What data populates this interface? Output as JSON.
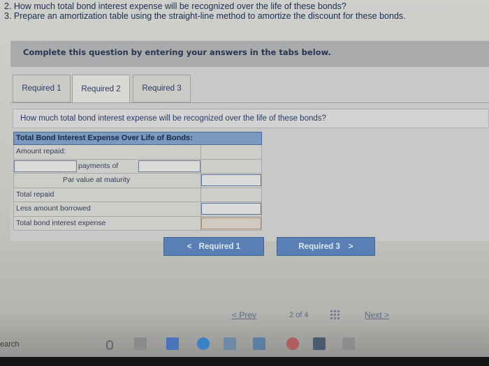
{
  "instructions": {
    "line2": "2. How much total bond interest expense will be recognized over the life of these bonds?",
    "line3": "3. Prepare an amortization table using the straight-line method to amortize the discount for these bonds."
  },
  "banner": "Complete this question by entering your answers in the tabs below.",
  "tabs": [
    {
      "label": "Required 1"
    },
    {
      "label": "Required 2"
    },
    {
      "label": "Required 3"
    }
  ],
  "question": "How much total bond interest expense will be recognized over the life of these bonds?",
  "table": {
    "header": "Total Bond Interest Expense Over Life of Bonds:",
    "rows": {
      "amount_repaid": "Amount repaid:",
      "payments_of": "payments of",
      "par_value": "Par value at maturity",
      "total_repaid": "Total repaid",
      "less_borrowed": "Less amount borrowed",
      "total_expense": "Total bond interest expense"
    }
  },
  "nav": {
    "prev_label": "Required 1",
    "next_label": "Required 3",
    "prev_arrow": "<",
    "next_arrow": ">"
  },
  "pager": {
    "prev": "Prev",
    "current": "2",
    "of": "of",
    "total": "4",
    "next": "Next"
  },
  "taskbar": {
    "search": "earch"
  }
}
